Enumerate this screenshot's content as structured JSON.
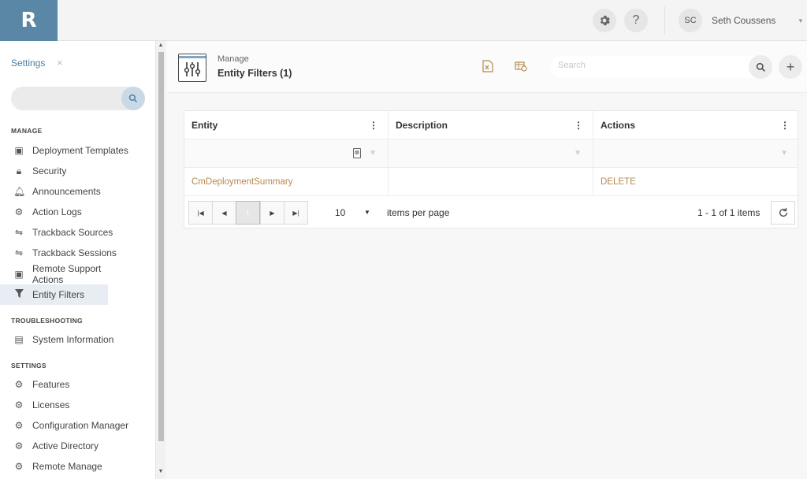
{
  "app": {
    "logo_letter": "R"
  },
  "topbar": {
    "settings_icon": "gear-icon",
    "help_label": "?",
    "user_initials": "SC",
    "user_name": "Seth Coussens"
  },
  "sidebar": {
    "header": "Settings",
    "close_label": "×",
    "search_placeholder": "",
    "sections": [
      {
        "title": "MANAGE"
      },
      {
        "title": "TROUBLESHOOTING"
      },
      {
        "title": "SETTINGS"
      }
    ],
    "items": [
      {
        "label": "Deployment Templates",
        "icon": "template-icon"
      },
      {
        "label": "Security",
        "icon": "lock-icon"
      },
      {
        "label": "Announcements",
        "icon": "bell-icon"
      },
      {
        "label": "Action Logs",
        "icon": "gears-icon"
      },
      {
        "label": "Trackback Sources",
        "icon": "handshake-icon"
      },
      {
        "label": "Trackback Sessions",
        "icon": "handshake-icon"
      },
      {
        "label": "Remote Support Actions",
        "icon": "template-icon"
      },
      {
        "label": "Entity Filters",
        "icon": "filter-icon",
        "active": true
      },
      {
        "label": "System Information",
        "icon": "info-icon"
      },
      {
        "label": "Features",
        "icon": "gear-icon"
      },
      {
        "label": "Licenses",
        "icon": "gear-icon"
      },
      {
        "label": "Configuration Manager",
        "icon": "gear-icon"
      },
      {
        "label": "Active Directory",
        "icon": "gear-icon"
      },
      {
        "label": "Remote Manage",
        "icon": "gear-icon"
      }
    ]
  },
  "main": {
    "breadcrumb": "Manage",
    "title": "Entity Filters (1)",
    "search_placeholder": "Search",
    "grid": {
      "columns": [
        "Entity",
        "Description",
        "Actions"
      ],
      "rows": [
        {
          "entity": "CmDeploymentSummary",
          "description": "",
          "action": "DELETE"
        }
      ]
    },
    "pager": {
      "current_page": "1",
      "page_size": "10",
      "per_page_label": "items per page",
      "count_label": "1 - 1 of 1 items"
    }
  },
  "colors": {
    "accent_blue": "#4a7fa6",
    "link_gold": "#b58a4f",
    "logo_bg": "#5b87a7"
  }
}
